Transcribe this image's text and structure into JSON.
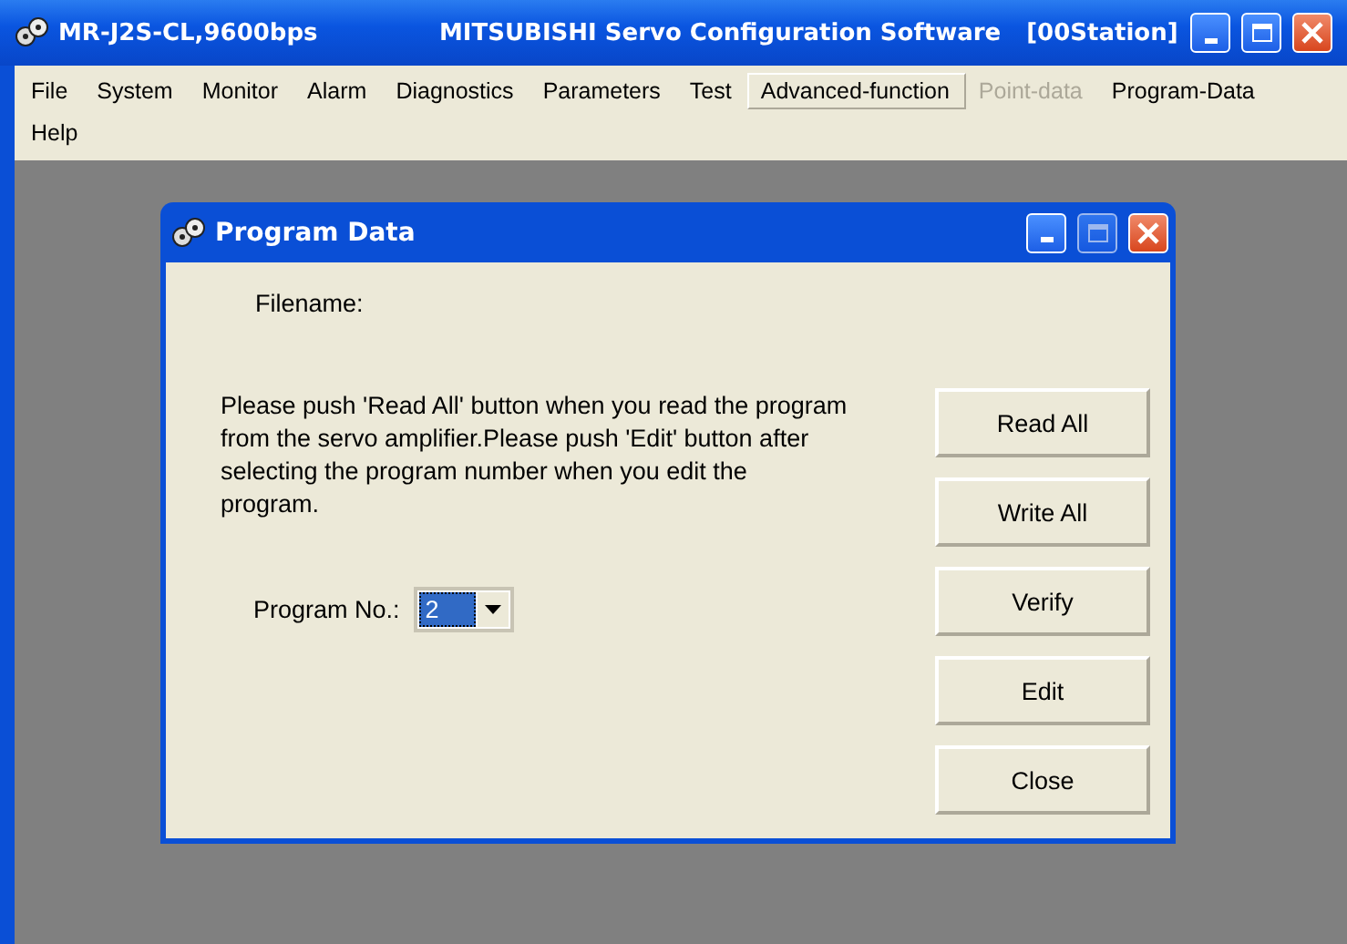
{
  "window": {
    "title_left": "MR-J2S-CL,9600bps",
    "title_center": "MITSUBISHI Servo Configuration Software",
    "title_right": "[00Station]"
  },
  "menu": [
    {
      "label": "File",
      "highlighted": false,
      "disabled": false
    },
    {
      "label": "System",
      "highlighted": false,
      "disabled": false
    },
    {
      "label": "Monitor",
      "highlighted": false,
      "disabled": false
    },
    {
      "label": "Alarm",
      "highlighted": false,
      "disabled": false
    },
    {
      "label": "Diagnostics",
      "highlighted": false,
      "disabled": false
    },
    {
      "label": "Parameters",
      "highlighted": false,
      "disabled": false
    },
    {
      "label": "Test",
      "highlighted": false,
      "disabled": false
    },
    {
      "label": "Advanced-function",
      "highlighted": true,
      "disabled": false
    },
    {
      "label": "Point-data",
      "highlighted": false,
      "disabled": true
    },
    {
      "label": "Program-Data",
      "highlighted": false,
      "disabled": false
    },
    {
      "label": "Help",
      "highlighted": false,
      "disabled": false
    }
  ],
  "dialog": {
    "title": "Program Data",
    "filename_label": "Filename:",
    "instructions": "Please push 'Read All' button when you read the program from the servo amplifier.Please push 'Edit' button after selecting the program number when you edit the program.",
    "program_no_label": "Program No.:",
    "program_no": "2",
    "buttons": [
      {
        "label": "Read All"
      },
      {
        "label": "Write All"
      },
      {
        "label": "Verify"
      },
      {
        "label": "Edit"
      },
      {
        "label": "Close"
      }
    ]
  }
}
